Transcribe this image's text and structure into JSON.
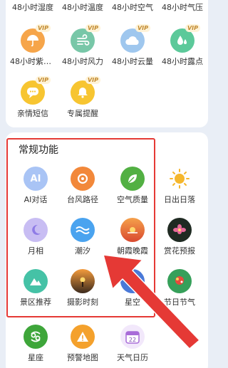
{
  "top_rows": {
    "row0": [
      "48小时湿度",
      "48小时温度",
      "48小时空气",
      "48小时气压"
    ],
    "row1": [
      {
        "label": "48小时紫外...",
        "icon": "umbrella-icon",
        "vip": "VIP"
      },
      {
        "label": "48小时风力",
        "icon": "wind-icon",
        "vip": "VIP"
      },
      {
        "label": "48小时云量",
        "icon": "cloud-icon",
        "vip": "VIP"
      },
      {
        "label": "48小时露点",
        "icon": "dewpoint-icon",
        "vip": "VIP"
      }
    ],
    "row2": [
      {
        "label": "亲情短信",
        "icon": "message-icon",
        "vip": "VIP"
      },
      {
        "label": "专属提醒",
        "icon": "bell-icon",
        "vip": "VIP"
      }
    ]
  },
  "section": {
    "title": "常规功能",
    "items": [
      {
        "label": "AI对话",
        "icon": "ai-chat-icon",
        "color": "#5b8def"
      },
      {
        "label": "台风路径",
        "icon": "typhoon-icon",
        "color": "#f2883a"
      },
      {
        "label": "空气质量",
        "icon": "leaf-icon",
        "color": "#52b043"
      },
      {
        "label": "日出日落",
        "icon": "sun-icon",
        "color": "#f5b72d"
      },
      {
        "label": "月相",
        "icon": "moon-icon",
        "color": "#8e7be6"
      },
      {
        "label": "潮汐",
        "icon": "tide-icon",
        "color": "#4aa3ef"
      },
      {
        "label": "朝霞晚霞",
        "icon": "sunset-icon",
        "color": "#e7643c"
      },
      {
        "label": "赏花预报",
        "icon": "flower-icon",
        "color": "#1f2a22"
      },
      {
        "label": "景区推荐",
        "icon": "mountain-icon",
        "color": "#45c2a6"
      },
      {
        "label": "摄影时刻",
        "icon": "photo-time-icon",
        "color": "#3c2a1d"
      },
      {
        "label": "星空",
        "icon": "starry-sky-icon",
        "color": "#4a79d8"
      },
      {
        "label": "节日节气",
        "icon": "festival-icon",
        "color": "#36a05a"
      },
      {
        "label": "星座",
        "icon": "cancer-sign-icon",
        "color": "#3ea63a"
      },
      {
        "label": "预警地图",
        "icon": "warning-map-icon",
        "color": "#f4a12c"
      },
      {
        "label": "天气日历",
        "icon": "calendar-icon",
        "color": "#a86bd8",
        "day": "22"
      }
    ]
  }
}
